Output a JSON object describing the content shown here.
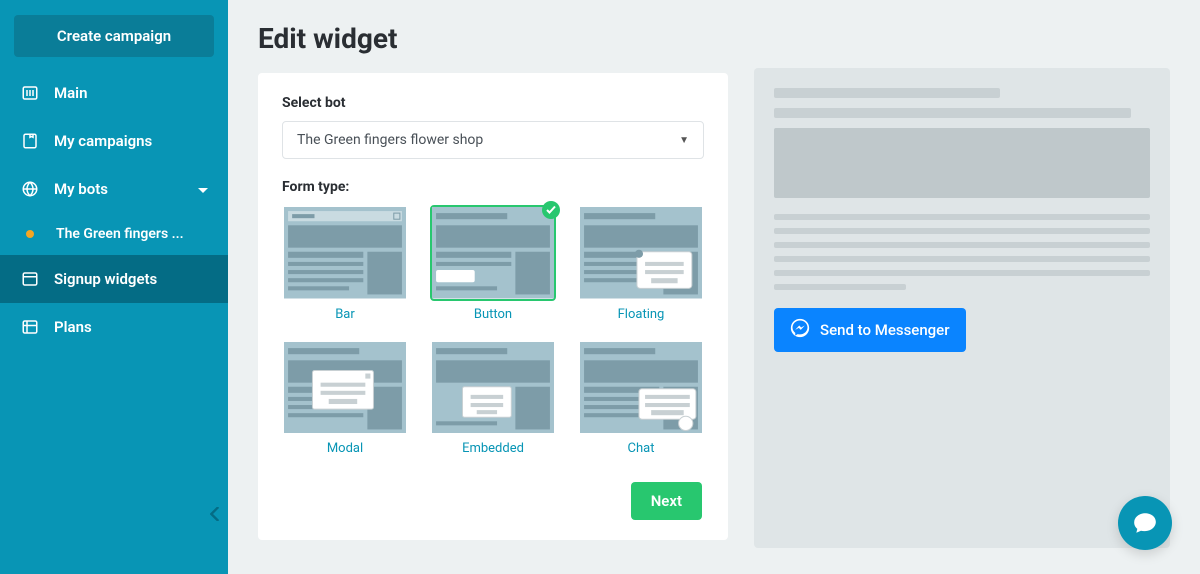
{
  "sidebar": {
    "create_button": "Create campaign",
    "items": [
      {
        "label": "Main"
      },
      {
        "label": "My campaigns"
      },
      {
        "label": "My bots"
      },
      {
        "label": "The Green fingers ..."
      },
      {
        "label": "Signup widgets"
      },
      {
        "label": "Plans"
      }
    ]
  },
  "page": {
    "title": "Edit widget",
    "select_bot_label": "Select bot",
    "select_bot_value": "The Green fingers flower shop",
    "form_type_label": "Form type:",
    "tiles": [
      {
        "label": "Bar"
      },
      {
        "label": "Button"
      },
      {
        "label": "Floating"
      },
      {
        "label": "Modal"
      },
      {
        "label": "Embedded"
      },
      {
        "label": "Chat"
      }
    ],
    "next_button": "Next",
    "messenger_button": "Send to Messenger"
  }
}
